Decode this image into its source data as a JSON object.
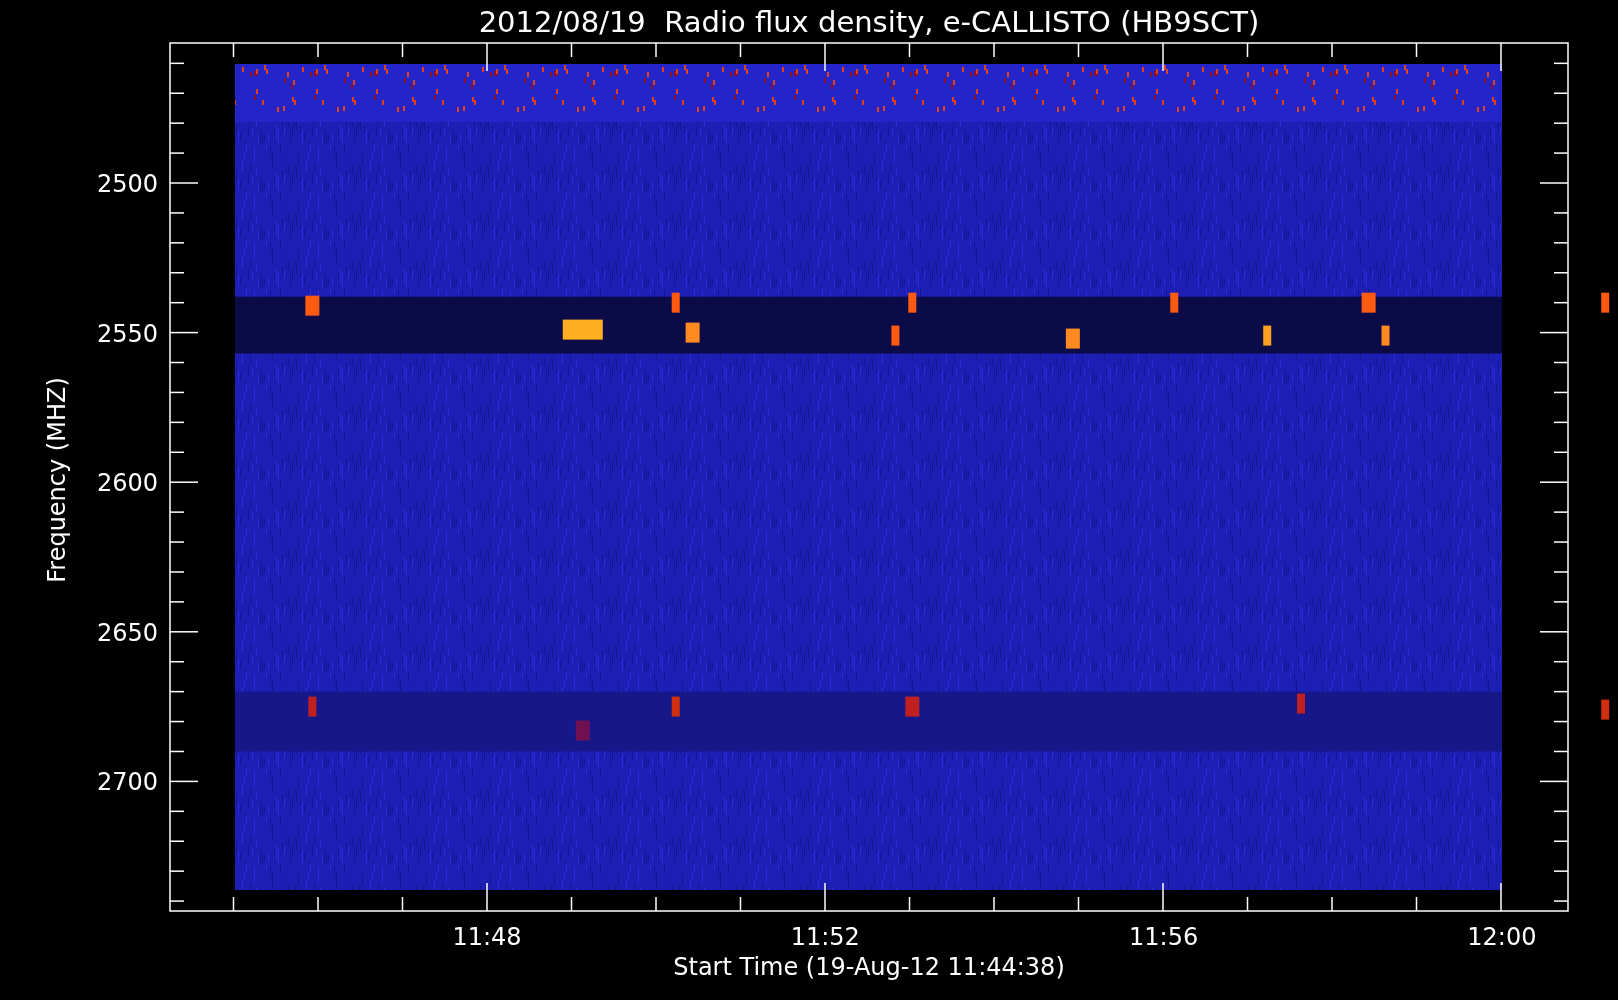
{
  "title": "2012/08/19  Radio flux density, e-CALLISTO (HB9SCT)",
  "y_axis": {
    "label": "Frequency (MHZ)",
    "ticks": [
      "2500",
      "2550",
      "2600",
      "2650",
      "2700"
    ]
  },
  "x_axis": {
    "label": "Start Time (19-Aug-12 11:44:38)",
    "ticks": [
      "11:48",
      "11:52",
      "11:56",
      "12:00"
    ]
  }
}
